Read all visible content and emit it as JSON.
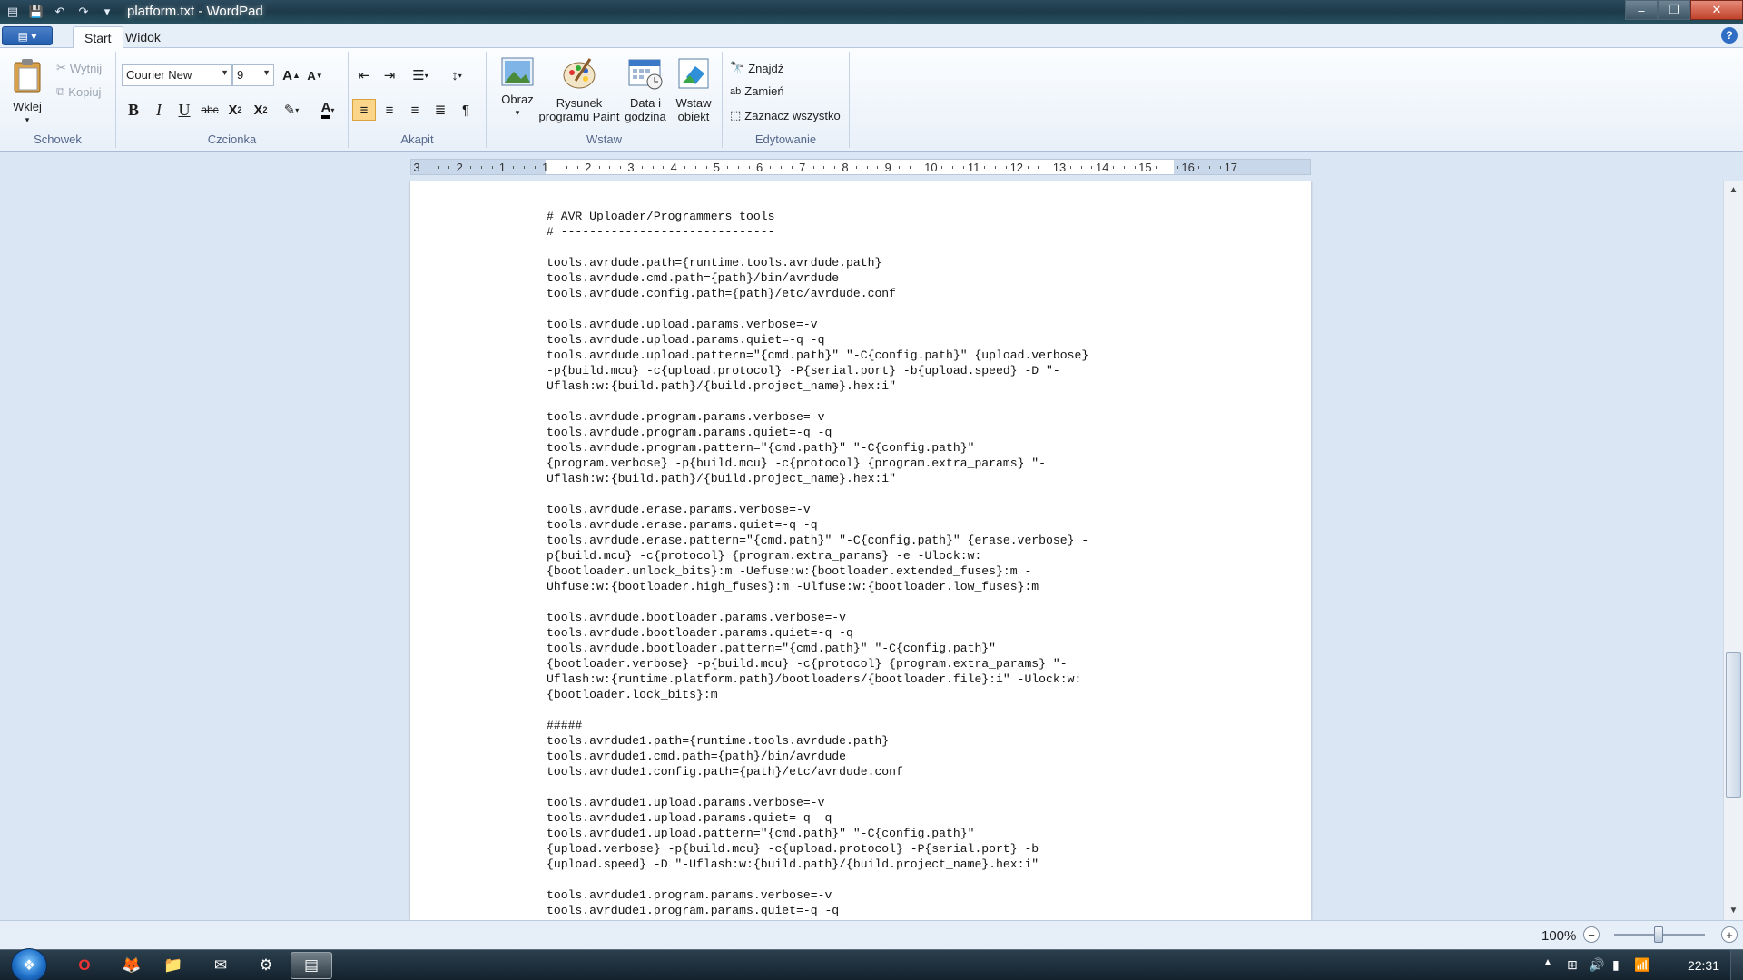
{
  "window": {
    "title": "platform.txt - WordPad",
    "controls": {
      "minimize": "–",
      "maximize": "❐",
      "close": "✕"
    }
  },
  "quick_access": {
    "save_icon": "save-icon",
    "undo_icon": "undo-icon",
    "redo_icon": "redo-icon",
    "customize_icon": "customize-icon"
  },
  "tabs": {
    "start": "Start",
    "view": "Widok",
    "help": "?"
  },
  "ribbon": {
    "clipboard": {
      "label": "Schowek",
      "paste": "Wklej",
      "cut": "Wytnij",
      "copy": "Kopiuj"
    },
    "font": {
      "label": "Czcionka",
      "family": "Courier New",
      "size": "9"
    },
    "paragraph": {
      "label": "Akapit"
    },
    "insert": {
      "label": "Wstaw",
      "picture": "Obraz",
      "paint_line1": "Rysunek",
      "paint_line2": "programu Paint",
      "datetime_line1": "Data i",
      "datetime_line2": "godzina",
      "object_line1": "Wstaw",
      "object_line2": "obiekt"
    },
    "editing": {
      "label": "Edytowanie",
      "find": "Znajdź",
      "replace": "Zamień",
      "select_all": "Zaznacz wszystko"
    }
  },
  "ruler": {
    "numbers": [
      "3",
      "2",
      "1",
      "1",
      "2",
      "3",
      "4",
      "5",
      "6",
      "7",
      "8",
      "9",
      "10",
      "11",
      "12",
      "13",
      "14",
      "15",
      "16",
      "17"
    ]
  },
  "document": {
    "text": "# AVR Uploader/Programmers tools\n# ------------------------------\n\ntools.avrdude.path={runtime.tools.avrdude.path}\ntools.avrdude.cmd.path={path}/bin/avrdude\ntools.avrdude.config.path={path}/etc/avrdude.conf\n\ntools.avrdude.upload.params.verbose=-v\ntools.avrdude.upload.params.quiet=-q -q\ntools.avrdude.upload.pattern=\"{cmd.path}\" \"-C{config.path}\" {upload.verbose}\n-p{build.mcu} -c{upload.protocol} -P{serial.port} -b{upload.speed} -D \"-\nUflash:w:{build.path}/{build.project_name}.hex:i\"\n\ntools.avrdude.program.params.verbose=-v\ntools.avrdude.program.params.quiet=-q -q\ntools.avrdude.program.pattern=\"{cmd.path}\" \"-C{config.path}\"\n{program.verbose} -p{build.mcu} -c{protocol} {program.extra_params} \"-\nUflash:w:{build.path}/{build.project_name}.hex:i\"\n\ntools.avrdude.erase.params.verbose=-v\ntools.avrdude.erase.params.quiet=-q -q\ntools.avrdude.erase.pattern=\"{cmd.path}\" \"-C{config.path}\" {erase.verbose} -\np{build.mcu} -c{protocol} {program.extra_params} -e -Ulock:w:\n{bootloader.unlock_bits}:m -Uefuse:w:{bootloader.extended_fuses}:m -\nUhfuse:w:{bootloader.high_fuses}:m -Ulfuse:w:{bootloader.low_fuses}:m\n\ntools.avrdude.bootloader.params.verbose=-v\ntools.avrdude.bootloader.params.quiet=-q -q\ntools.avrdude.bootloader.pattern=\"{cmd.path}\" \"-C{config.path}\"\n{bootloader.verbose} -p{build.mcu} -c{protocol} {program.extra_params} \"-\nUflash:w:{runtime.platform.path}/bootloaders/{bootloader.file}:i\" -Ulock:w:\n{bootloader.lock_bits}:m\n\n#####\ntools.avrdude1.path={runtime.tools.avrdude.path}\ntools.avrdude1.cmd.path={path}/bin/avrdude\ntools.avrdude1.config.path={path}/etc/avrdude.conf\n\ntools.avrdude1.upload.params.verbose=-v\ntools.avrdude1.upload.params.quiet=-q -q\ntools.avrdude1.upload.pattern=\"{cmd.path}\" \"-C{config.path}\"\n{upload.verbose} -p{build.mcu} -c{upload.protocol} -P{serial.port} -b\n{upload.speed} -D \"-Uflash:w:{build.path}/{build.project_name}.hex:i\"\n\ntools.avrdude1.program.params.verbose=-v\ntools.avrdude1.program.params.quiet=-q -q"
  },
  "statusbar": {
    "zoom": "100%",
    "zoom_out": "−",
    "zoom_in": "+",
    "zoom_level": 1.0
  },
  "taskbar": {
    "items": [
      "opera-icon",
      "fox-icon",
      "folder-icon",
      "thunderbird-icon",
      "tool-icon",
      "wordpad-icon"
    ],
    "clock": "22:31"
  }
}
